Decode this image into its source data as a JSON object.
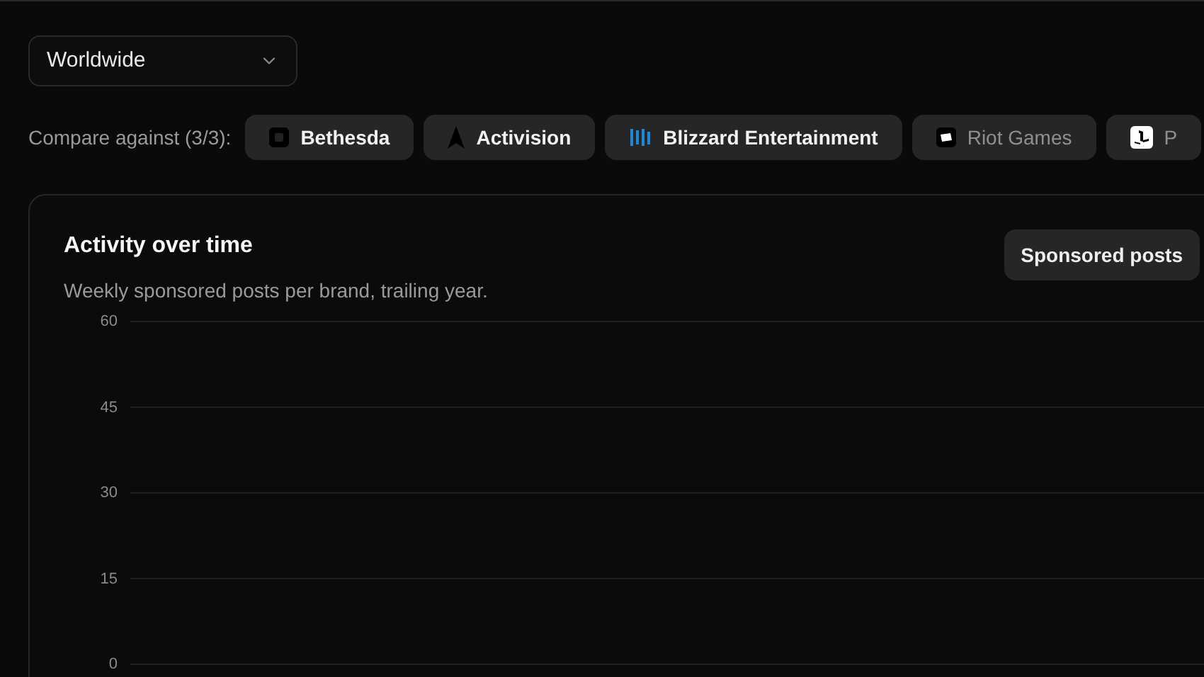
{
  "region_select": {
    "value": "Worldwide"
  },
  "compare": {
    "label": "Compare against (3/3):",
    "brands": [
      {
        "name": "Bethesda",
        "kind": "bethesda",
        "selected": true
      },
      {
        "name": "Activision",
        "kind": "activision",
        "selected": true
      },
      {
        "name": "Blizzard Entertainment",
        "kind": "blizzard",
        "selected": true
      },
      {
        "name": "Riot Games",
        "kind": "riot",
        "selected": false
      },
      {
        "name": "P",
        "kind": "playstation",
        "selected": false
      }
    ]
  },
  "card": {
    "title": "Activity over time",
    "subtitle": "Weekly sponsored posts per brand, trailing year.",
    "metric_button": "Sponsored posts",
    "y_axis_labels": [
      "60",
      "45",
      "30",
      "15",
      "0"
    ]
  }
}
